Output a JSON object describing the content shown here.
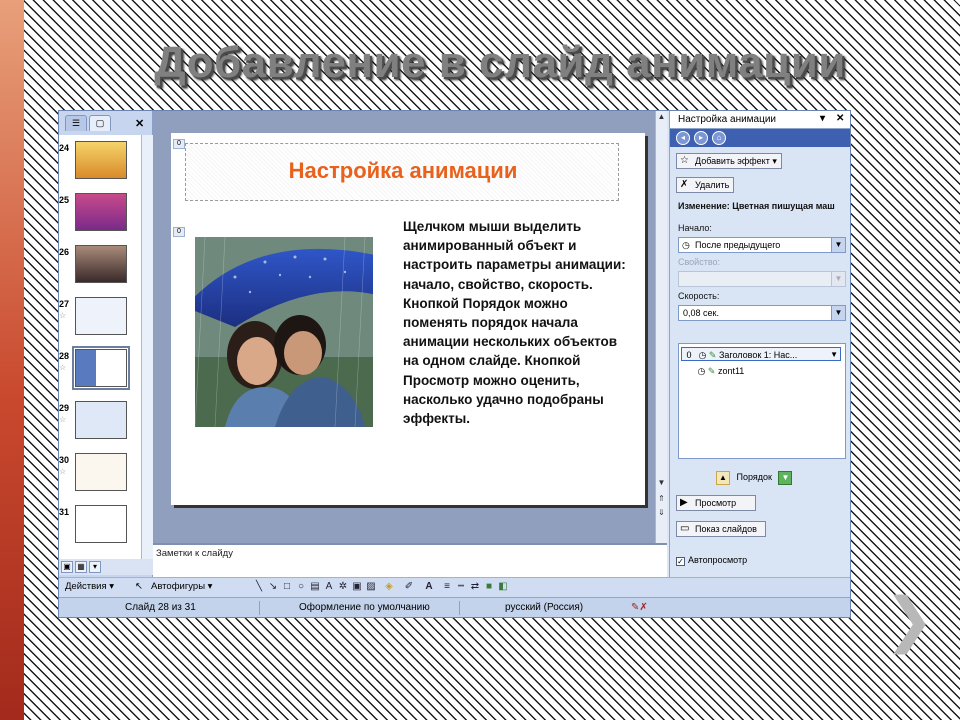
{
  "slide": {
    "title": "Добавление в слайд анимации",
    "next_arrow": "❯"
  },
  "app": {
    "thumbnails": {
      "tab_outline_icon": "☰",
      "tab_slides_icon": "▢",
      "close": "✕",
      "items": [
        {
          "num": "24",
          "selected": false,
          "color": "#d9a84a"
        },
        {
          "num": "25",
          "selected": false,
          "color": "#a83a7a"
        },
        {
          "num": "26",
          "selected": false,
          "color": "#7a5a4a"
        },
        {
          "num": "27",
          "selected": false,
          "color": "#e8eefa"
        },
        {
          "num": "28",
          "selected": true,
          "color": "#f4f4f4"
        },
        {
          "num": "29",
          "selected": false,
          "color": "#eef3fb"
        },
        {
          "num": "30",
          "selected": false,
          "color": "#fbf7ee"
        },
        {
          "num": "31",
          "selected": false,
          "color": "#ffffff"
        }
      ]
    },
    "editor": {
      "slide_title": "Настройка анимации",
      "anim_tag_title": "0",
      "anim_tag_image": "0",
      "body_text": "Щелчком мыши выделить анимированный объект и настроить параметры анимации: начало, свойство, скорость. Кнопкой Порядок можно поменять порядок начала анимации нескольких объектов на одном слайде. Кнопкой Просмотр можно оценить, насколько удачно подобраны  эффекты."
    },
    "notes": {
      "placeholder": "Заметки к слайду"
    },
    "task_pane": {
      "title": "Настройка анимации",
      "add_effect": "Добавить эффект",
      "remove": "Удалить",
      "change_label": "Изменение: Цветная пишущая маш",
      "start_label": "Начало:",
      "start_value": "После предыдущего",
      "property_label": "Свойство:",
      "property_value": "",
      "speed_label": "Скорость:",
      "speed_value": "0,08 сек.",
      "list": [
        {
          "order": "0",
          "name": "Заголовок 1: Нас..."
        },
        {
          "order": "",
          "name": "zont11"
        }
      ],
      "order_label": "Порядок",
      "preview": "Просмотр",
      "slideshow": "Показ слайдов",
      "autopreview": "Автопросмотр",
      "autopreview_checked": true
    },
    "drawing_toolbar": {
      "actions": "Действия",
      "autoshapes": "Автофигуры"
    },
    "status_bar": {
      "slide": "Слайд 28 из 31",
      "design": "Оформление по умолчанию",
      "language": "русский (Россия)"
    }
  }
}
